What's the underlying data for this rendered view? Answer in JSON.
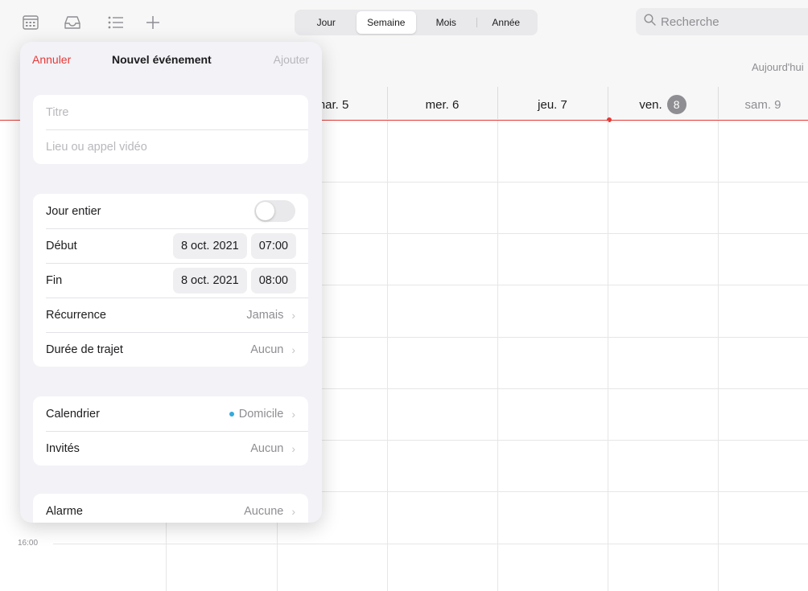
{
  "toolbar": {
    "icons": [
      "calendars-icon",
      "inbox-icon",
      "list-icon",
      "add-icon"
    ],
    "views": [
      "Jour",
      "Semaine",
      "Mois",
      "Année"
    ],
    "active_view": "Semaine",
    "search_placeholder": "Recherche"
  },
  "week": {
    "today_link": "Aujourd'hui",
    "days": [
      {
        "label": "mar. 5"
      },
      {
        "label": "mer. 6"
      },
      {
        "label": "jeu. 7"
      },
      {
        "label": "ven.",
        "badge": "8"
      },
      {
        "label": "sam. 9"
      }
    ]
  },
  "grid": {
    "hour_label": "16:00"
  },
  "event_form": {
    "cancel": "Annuler",
    "title": "Nouvel événement",
    "add": "Ajouter",
    "title_placeholder": "Titre",
    "location_placeholder": "Lieu ou appel vidéo",
    "all_day_label": "Jour entier",
    "all_day_on": false,
    "start_label": "Début",
    "start_date": "8 oct. 2021",
    "start_time": "07:00",
    "end_label": "Fin",
    "end_date": "8 oct. 2021",
    "end_time": "08:00",
    "recurrence_label": "Récurrence",
    "recurrence_value": "Jamais",
    "travel_label": "Durée de trajet",
    "travel_value": "Aucun",
    "calendar_label": "Calendrier",
    "calendar_value": "Domicile",
    "calendar_color": "#34aadc",
    "invitees_label": "Invités",
    "invitees_value": "Aucun",
    "alarm_label": "Alarme",
    "alarm_value": "Aucune"
  },
  "colors": {
    "accent_red": "#e53935",
    "secondary_text": "#8e8e93"
  }
}
